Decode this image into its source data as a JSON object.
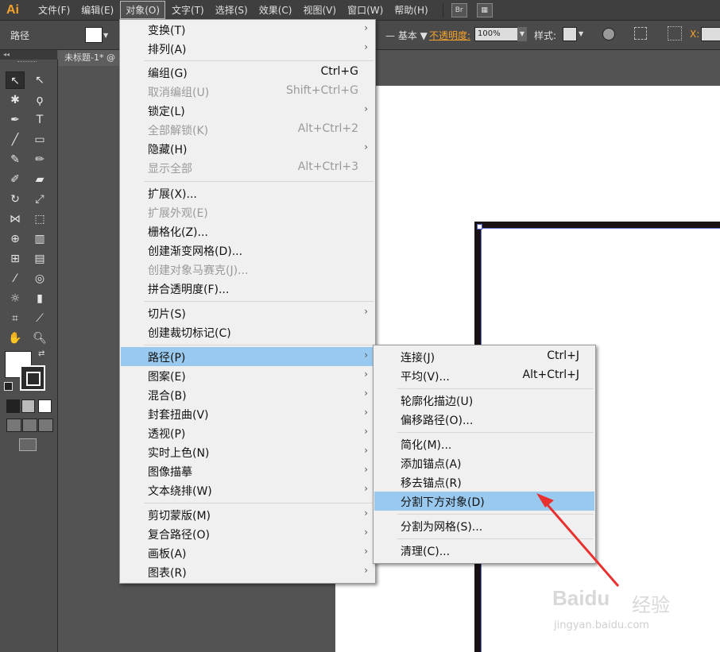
{
  "app": {
    "logo": "Ai"
  },
  "menubar": {
    "items": [
      "文件(F)",
      "编辑(E)",
      "对象(O)",
      "文字(T)",
      "选择(S)",
      "效果(C)",
      "视图(V)",
      "窗口(W)",
      "帮助(H)"
    ],
    "active_index": 2,
    "bridge_icon": "Br"
  },
  "control_bar": {
    "selection_label": "路径",
    "stroke_profile": "基本",
    "opacity_label": "不透明度:",
    "opacity_value": "100%",
    "style_label": "样式:",
    "x_label": "X:"
  },
  "document_tab": {
    "title": "未标题-1* @"
  },
  "object_menu": {
    "items": [
      {
        "label": "变换(T)",
        "shortcut": "",
        "submenu": true,
        "disabled": false
      },
      {
        "label": "排列(A)",
        "shortcut": "",
        "submenu": true,
        "disabled": false
      },
      {
        "label": "编组(G)",
        "shortcut": "Ctrl+G",
        "submenu": false,
        "disabled": false
      },
      {
        "label": "取消编组(U)",
        "shortcut": "Shift+Ctrl+G",
        "submenu": false,
        "disabled": true
      },
      {
        "label": "锁定(L)",
        "shortcut": "",
        "submenu": true,
        "disabled": false
      },
      {
        "label": "全部解锁(K)",
        "shortcut": "Alt+Ctrl+2",
        "submenu": false,
        "disabled": true
      },
      {
        "label": "隐藏(H)",
        "shortcut": "",
        "submenu": true,
        "disabled": false
      },
      {
        "label": "显示全部",
        "shortcut": "Alt+Ctrl+3",
        "submenu": false,
        "disabled": true
      },
      {
        "label": "扩展(X)...",
        "shortcut": "",
        "submenu": false,
        "disabled": false
      },
      {
        "label": "扩展外观(E)",
        "shortcut": "",
        "submenu": false,
        "disabled": true
      },
      {
        "label": "栅格化(Z)...",
        "shortcut": "",
        "submenu": false,
        "disabled": false
      },
      {
        "label": "创建渐变网格(D)...",
        "shortcut": "",
        "submenu": false,
        "disabled": false
      },
      {
        "label": "创建对象马赛克(J)...",
        "shortcut": "",
        "submenu": false,
        "disabled": true
      },
      {
        "label": "拼合透明度(F)...",
        "shortcut": "",
        "submenu": false,
        "disabled": false
      },
      {
        "label": "切片(S)",
        "shortcut": "",
        "submenu": true,
        "disabled": false
      },
      {
        "label": "创建裁切标记(C)",
        "shortcut": "",
        "submenu": false,
        "disabled": false
      },
      {
        "label": "路径(P)",
        "shortcut": "",
        "submenu": true,
        "disabled": false,
        "highlighted": true
      },
      {
        "label": "图案(E)",
        "shortcut": "",
        "submenu": true,
        "disabled": false
      },
      {
        "label": "混合(B)",
        "shortcut": "",
        "submenu": true,
        "disabled": false
      },
      {
        "label": "封套扭曲(V)",
        "shortcut": "",
        "submenu": true,
        "disabled": false
      },
      {
        "label": "透视(P)",
        "shortcut": "",
        "submenu": true,
        "disabled": false
      },
      {
        "label": "实时上色(N)",
        "shortcut": "",
        "submenu": true,
        "disabled": false
      },
      {
        "label": "图像描摹",
        "shortcut": "",
        "submenu": true,
        "disabled": false
      },
      {
        "label": "文本绕排(W)",
        "shortcut": "",
        "submenu": true,
        "disabled": false
      },
      {
        "label": "剪切蒙版(M)",
        "shortcut": "",
        "submenu": true,
        "disabled": false
      },
      {
        "label": "复合路径(O)",
        "shortcut": "",
        "submenu": true,
        "disabled": false
      },
      {
        "label": "画板(A)",
        "shortcut": "",
        "submenu": true,
        "disabled": false
      },
      {
        "label": "图表(R)",
        "shortcut": "",
        "submenu": true,
        "disabled": false
      }
    ]
  },
  "path_submenu": {
    "items": [
      {
        "label": "连接(J)",
        "shortcut": "Ctrl+J"
      },
      {
        "label": "平均(V)...",
        "shortcut": "Alt+Ctrl+J"
      },
      {
        "label": "轮廓化描边(U)",
        "shortcut": ""
      },
      {
        "label": "偏移路径(O)...",
        "shortcut": ""
      },
      {
        "label": "简化(M)...",
        "shortcut": ""
      },
      {
        "label": "添加锚点(A)",
        "shortcut": ""
      },
      {
        "label": "移去锚点(R)",
        "shortcut": ""
      },
      {
        "label": "分割下方对象(D)",
        "shortcut": "",
        "highlighted": true
      },
      {
        "label": "分割为网格(S)...",
        "shortcut": ""
      },
      {
        "label": "清理(C)...",
        "shortcut": ""
      }
    ]
  },
  "watermark": {
    "brand": "Baidu",
    "brand_cn": "经验",
    "url": "jingyan.baidu.com"
  },
  "colors": {
    "accent": "#f7a32b",
    "highlight": "#99c9ef",
    "annotation_arrow": "#e8312f"
  }
}
